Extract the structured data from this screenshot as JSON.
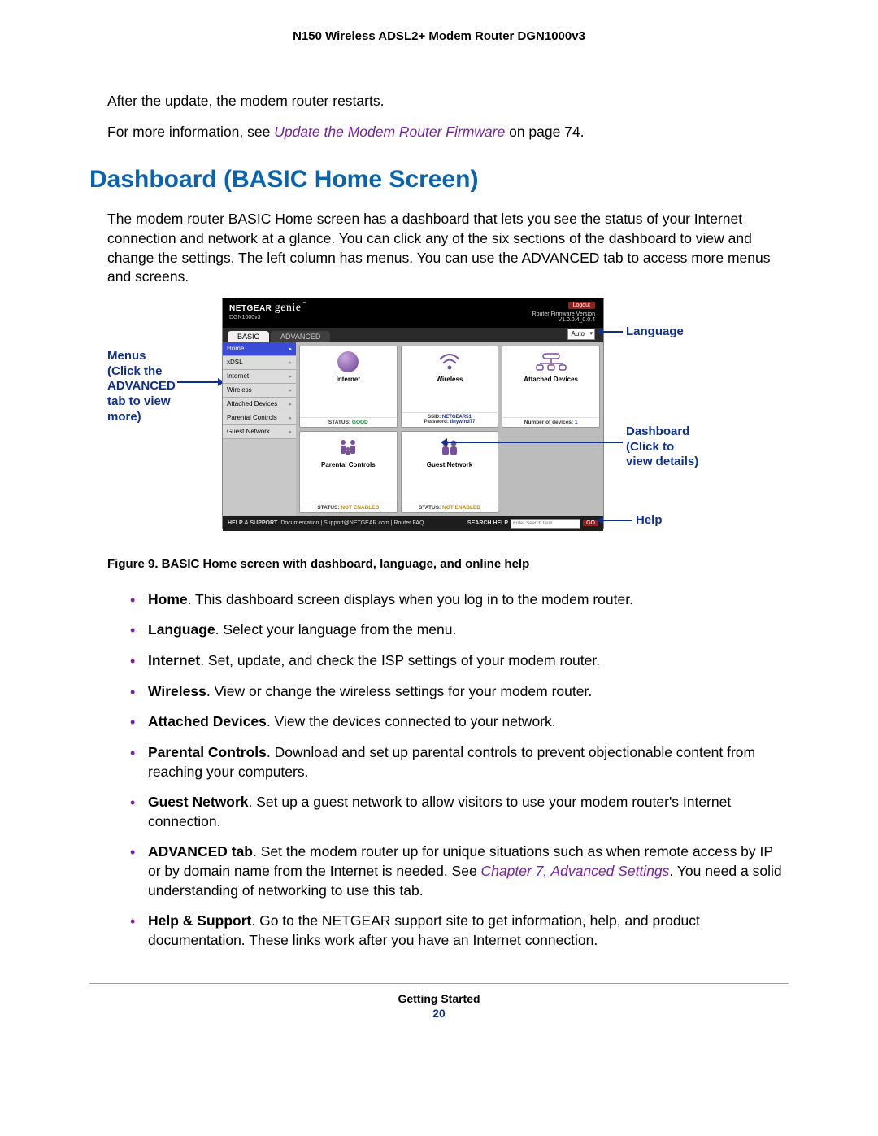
{
  "header": {
    "product_title": "N150 Wireless ADSL2+ Modem Router DGN1000v3"
  },
  "intro": {
    "p1": "After the update, the modem router restarts.",
    "p2_pre": "For more information, see ",
    "p2_link": "Update the Modem Router Firmware",
    "p2_post": " on page 74."
  },
  "section_title": "Dashboard (BASIC Home Screen)",
  "section_para": "The modem router BASIC Home screen has a dashboard that lets you see the status of your Internet connection and network at a glance. You can click any of the six sections of the dashboard to view and change the settings. The left column has menus. You can use the ADVANCED tab to access more menus and screens.",
  "callouts": {
    "menus_l1": "Menus",
    "menus_l2": "(Click the",
    "menus_l3": "ADVANCED",
    "menus_l4": "tab to view",
    "menus_l5": "more)",
    "language": "Language",
    "dashboard_l1": "Dashboard",
    "dashboard_l2": "(Click to",
    "dashboard_l3": "view details)",
    "help": "Help"
  },
  "router": {
    "brand": "NETGEAR",
    "brand_suffix": "genie",
    "brand_tm": "™",
    "model": "DGN1000v3",
    "logout": "Logout",
    "fw_label": "Router Firmware Version",
    "fw_ver": "V1.0.0.4_0.0.4",
    "tab_basic": "BASIC",
    "tab_advanced": "ADVANCED",
    "lang": "Auto",
    "sidebar": [
      {
        "label": "Home",
        "active": true
      },
      {
        "label": "xDSL",
        "active": false
      },
      {
        "label": "Internet",
        "active": false
      },
      {
        "label": "Wireless",
        "active": false
      },
      {
        "label": "Attached Devices",
        "active": false
      },
      {
        "label": "Parental Controls",
        "active": false
      },
      {
        "label": "Guest Network",
        "active": false
      }
    ],
    "tiles": {
      "internet": {
        "title": "Internet",
        "status_label": "STATUS:",
        "status_val": "GOOD"
      },
      "wireless": {
        "title": "Wireless",
        "ssid_label": "SSID:",
        "ssid": "NETGEAR51",
        "pwd_label": "Password:",
        "pwd": "tinywind77"
      },
      "attached": {
        "title": "Attached Devices",
        "count_label": "Number of devices:",
        "count": "1"
      },
      "parental": {
        "title": "Parental Controls",
        "status_label": "STATUS:",
        "status_val": "NOT ENABLED"
      },
      "guest": {
        "title": "Guest Network",
        "status_label": "STATUS:",
        "status_val": "NOT ENABLED"
      }
    },
    "footer": {
      "help_support": "HELP & SUPPORT",
      "links": "Documentation | Support@NETGEAR.com | Router FAQ",
      "search_label": "SEARCH HELP",
      "search_placeholder": "Enter Search Item",
      "go": "GO"
    }
  },
  "figure_caption": "Figure 9. BASIC Home screen with dashboard, language, and online help",
  "bullets": [
    {
      "bold": "Home",
      "text": ". This dashboard screen displays when you log in to the modem router."
    },
    {
      "bold": "Language",
      "text": ". Select your language from the menu."
    },
    {
      "bold": "Internet",
      "text": ". Set, update, and check the ISP settings of your modem router."
    },
    {
      "bold": "Wireless",
      "text": ". View or change the wireless settings for your modem router."
    },
    {
      "bold": "Attached Devices",
      "text": ". View the devices connected to your network."
    },
    {
      "bold": "Parental Controls",
      "text": ". Download and set up parental controls to prevent objectionable content from reaching your computers."
    },
    {
      "bold": "Guest Network",
      "text": ". Set up a guest network to allow visitors to use your modem router's Internet connection."
    },
    {
      "bold": "ADVANCED tab",
      "text_pre": ". Set the modem router up for unique situations such as when remote access by IP or by domain name from the Internet is needed. See ",
      "link": "Chapter 7, Advanced Settings",
      "text_post": ". You need a solid understanding of networking to use this tab."
    },
    {
      "bold": "Help & Support",
      "text": ". Go to the NETGEAR support site to get information, help, and product documentation. These links work after you have an Internet connection."
    }
  ],
  "footer": {
    "section": "Getting Started",
    "page": "20"
  }
}
